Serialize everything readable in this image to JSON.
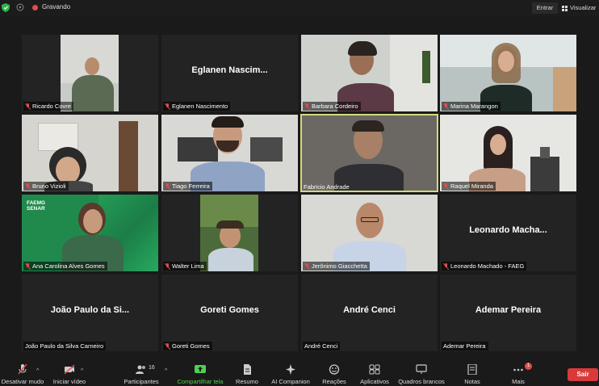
{
  "topbar": {
    "recording_label": "Gravando",
    "entrar_label": "Entrar",
    "visualizar_label": "Visualizar"
  },
  "participants": [
    {
      "name": "Ricardo Covre",
      "muted": true
    },
    {
      "name": "Eglanen Nascimento",
      "display": "Eglanen  Nascim...",
      "muted": true
    },
    {
      "name": "Barbara Cordeiro",
      "muted": true
    },
    {
      "name": "Marina Marangon",
      "muted": true
    },
    {
      "name": "Bruno Vizioli",
      "muted": true
    },
    {
      "name": "Tiago Ferreira",
      "muted": true
    },
    {
      "name": "Fabricio Andrade",
      "muted": false,
      "active": true
    },
    {
      "name": "Raquel Miranda",
      "muted": true
    },
    {
      "name": "Ana Carolina Alves Gomes",
      "muted": true,
      "logo_text": "FAEMG\nSENAR"
    },
    {
      "name": "Walter Lima",
      "muted": true
    },
    {
      "name": "Jerônimo Giacchetta",
      "muted": true
    },
    {
      "name": "Leonardo Machado - FAEG",
      "display": "Leonardo  Macha...",
      "muted": true
    },
    {
      "name": "João Paulo da Silva Carneiro",
      "display": "João Paulo da Si...",
      "muted": false
    },
    {
      "name": "Goreti Gomes",
      "display": "Goreti Gomes",
      "muted": true
    },
    {
      "name": "André Cenci",
      "display": "André Cenci",
      "muted": false
    },
    {
      "name": "Ademar Pereira",
      "display": "Ademar Pereira",
      "muted": false
    }
  ],
  "toolbar": {
    "mute": "Desativar mudo",
    "video": "Iniciar vídeo",
    "participants": "Participantes",
    "participants_count": "16",
    "share": "Compartilhar tela",
    "summary": "Resumo",
    "companion": "AI Companion",
    "reactions": "Reações",
    "apps": "Aplicativos",
    "whiteboards": "Quadros brancos",
    "notes": "Notas",
    "more": "Mais",
    "more_badge": "1",
    "leave": "Sair"
  },
  "colors": {
    "share_green": "#4fd04f",
    "leave_red": "#d83a3a",
    "active_border": "#d7d87a",
    "faemg_green": "#1f8a4c"
  }
}
